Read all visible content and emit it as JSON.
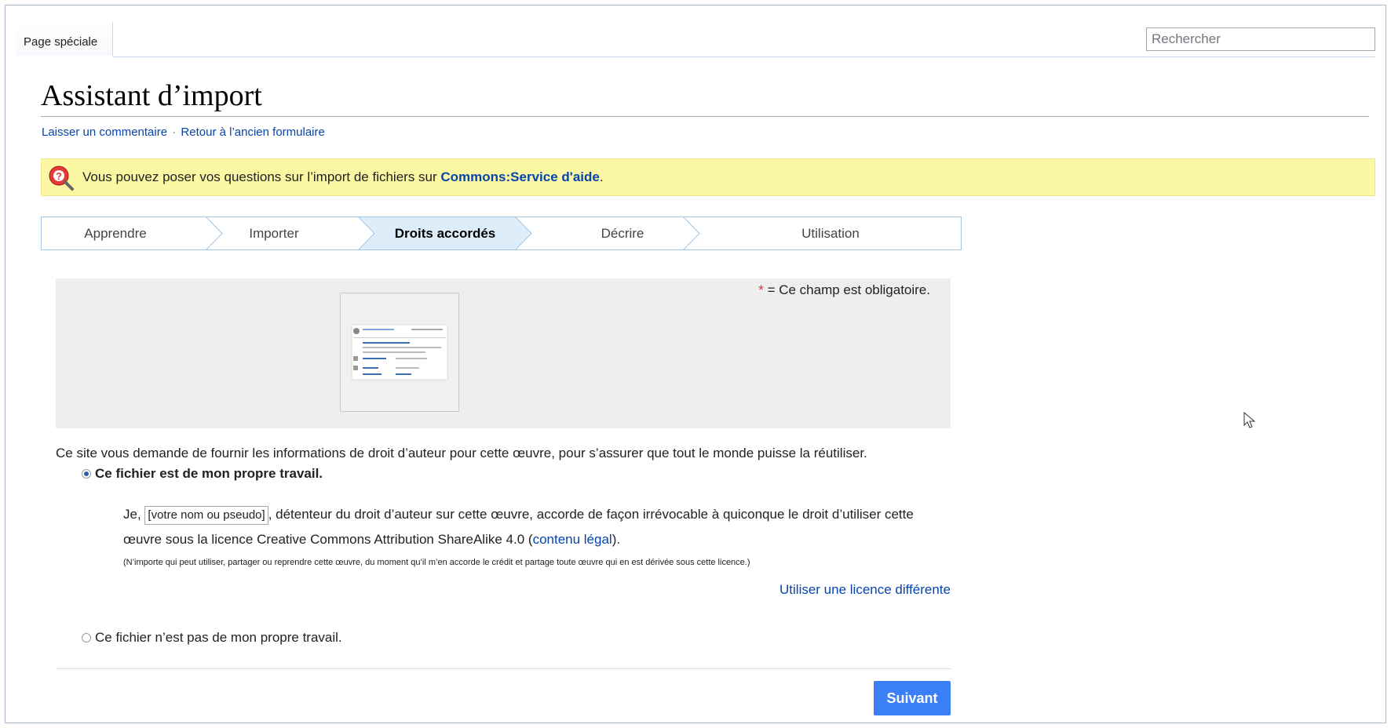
{
  "header": {
    "tab_label": "Page spéciale",
    "search_placeholder": "Rechercher"
  },
  "page": {
    "title": "Assistant d’import",
    "link_feedback": "Laisser un commentaire",
    "separator": "·",
    "link_old_form": "Retour à l’ancien formulaire"
  },
  "notice": {
    "text": "Vous pouvez poser vos questions sur l’import de fichiers sur ",
    "link": "Commons:Service d'aide",
    "end": "."
  },
  "steps": [
    {
      "label": "Apprendre",
      "active": false
    },
    {
      "label": "Importer",
      "active": false
    },
    {
      "label": "Droits accordés",
      "active": true
    },
    {
      "label": "Décrire",
      "active": false
    },
    {
      "label": "Utilisation",
      "active": false
    }
  ],
  "form": {
    "required_star": "*",
    "required_text": " = Ce champ est obligatoire.",
    "intro": "Ce site vous demande de fournir les informations de droit d’auteur pour cette œuvre, pour s’assurer que tout le monde puisse la réutiliser.",
    "own_work_label": "Ce fichier est de mon propre travail.",
    "decl_prefix": "Je,",
    "name_placeholder": "[votre nom ou pseudo]",
    "decl_middle": ", détenteur du droit d’auteur sur cette œuvre, accorde de façon irrévocable à quiconque le droit d’utiliser cette œuvre sous la licence Creative Commons Attribution ShareAlike 4.0 (",
    "legal_link": "contenu légal",
    "decl_end": ").",
    "fine_print": "(N’importe qui peut utiliser, partager ou reprendre cette œuvre, du moment qu’il m’en accorde le crédit et partage toute œuvre qui en est dérivée sous cette licence.)",
    "other_license_link": "Utiliser une licence différente",
    "not_own_work_label": "Ce fichier n’est pas de mon propre travail.",
    "own_work_selected": true,
    "next_button": "Suivant"
  },
  "colors": {
    "link": "#0645ad",
    "notice_bg": "#fbf7a2",
    "active_step_bg": "#ddeefa",
    "primary_button": "#3a7ff6"
  }
}
